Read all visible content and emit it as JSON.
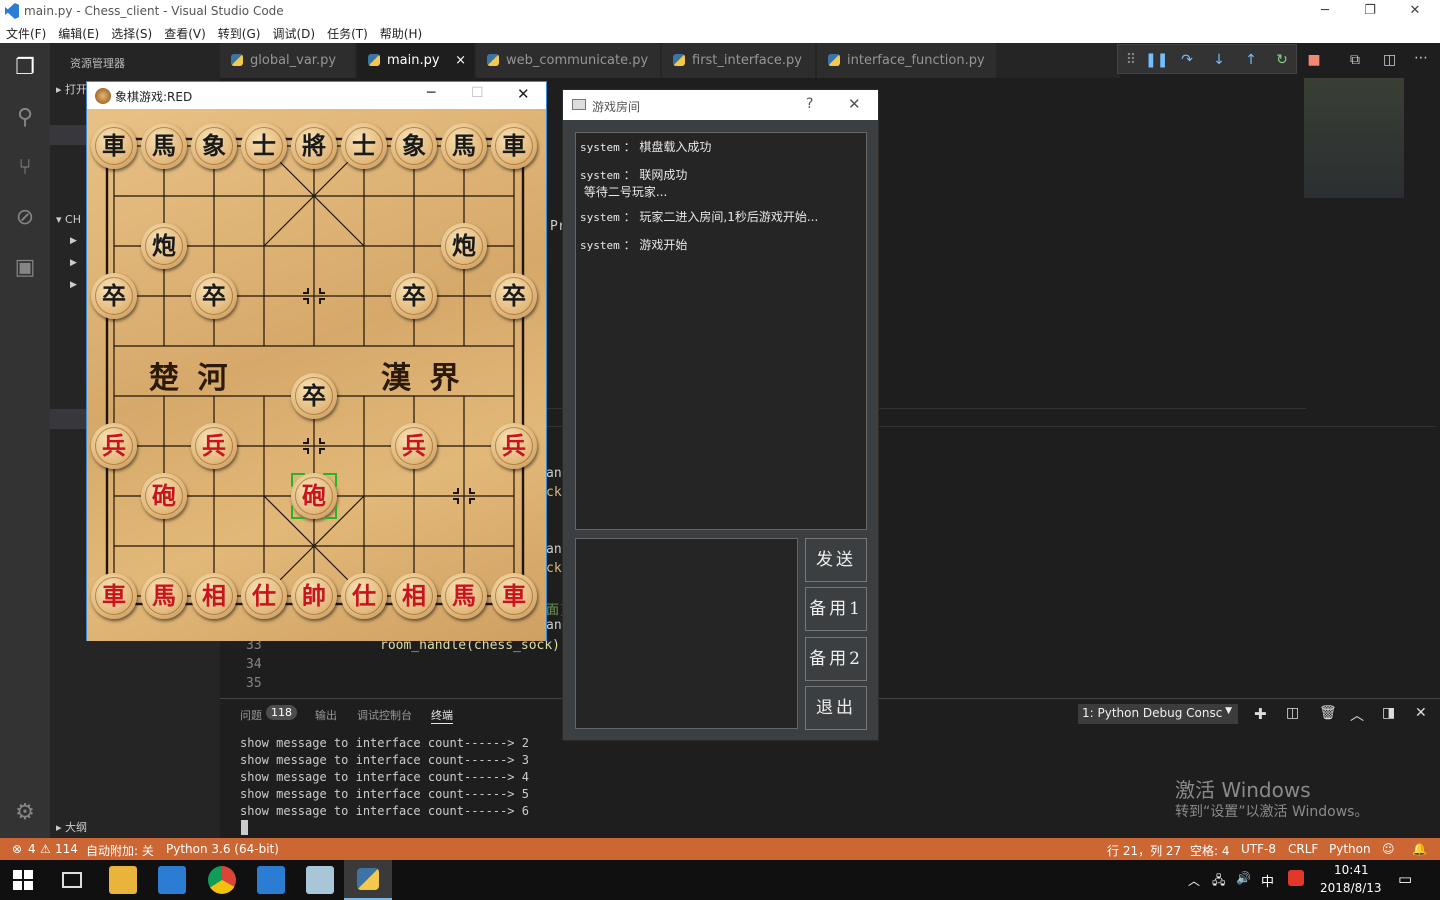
{
  "titlebar": {
    "title": "main.py - Chess_client - Visual Studio Code"
  },
  "menu": [
    "文件(F)",
    "编辑(E)",
    "选择(S)",
    "查看(V)",
    "转到(G)",
    "调试(D)",
    "任务(T)",
    "帮助(H)"
  ],
  "sidebar": {
    "header": "资源管理器",
    "open_label": "打开",
    "project_label": "CH",
    "outline_label": "大纲"
  },
  "tabs": [
    {
      "label": "global_var.py"
    },
    {
      "label": "main.py",
      "close": "×"
    },
    {
      "label": "web_communicate.py"
    },
    {
      "label": "first_interface.py"
    },
    {
      "label": "interface_function.py"
    }
  ],
  "editor": {
    "lines": [
      {
        "n": "33",
        "text": "room_handle(chess_sock)"
      },
      {
        "n": "34",
        "text": ""
      },
      {
        "n": "35",
        "text": ""
      }
    ],
    "fragments": [
      "Pr",
      "ank",
      "ck)",
      "ank",
      "ck)",
      "面)",
      "ank"
    ]
  },
  "panel": {
    "tabs": [
      "问题",
      "输出",
      "调试控制台",
      "终端"
    ],
    "problem_count": "118",
    "terminal_select": "1: Python Debug Consc",
    "terminal_lines": [
      "show message to interface count------> 2",
      "show message to interface count------> 3",
      "show message to interface count------> 4",
      "show message to interface count------> 5",
      "show message to interface count------> 6"
    ]
  },
  "status": {
    "errors": "4",
    "warnings": "114",
    "auto_attach": "自动附加: 关",
    "python": "Python 3.6 (64-bit)",
    "position": "行 21，列 27",
    "spaces": "空格: 4",
    "encoding": "UTF-8",
    "eol": "CRLF",
    "language": "Python"
  },
  "chess_window": {
    "title": "象棋游戏:RED",
    "river_left": "楚 河",
    "river_right": "漢 界"
  },
  "room_window": {
    "title": "游戏房间",
    "help": "?",
    "messages": [
      {
        "sender": "system",
        "text": "棋盘载入成功"
      },
      {
        "sender": "system",
        "text": "联网成功\n 等待二号玩家..."
      },
      {
        "sender": "system",
        "text": "玩家二进入房间,1秒后游戏开始..."
      },
      {
        "sender": "system",
        "text": "游戏开始"
      }
    ],
    "buttons": {
      "send": "发送",
      "spare1": "备用1",
      "spare2": "备用2",
      "quit": "退出"
    }
  },
  "watermark": {
    "line1": "激活 Windows",
    "line2": "转到“设置”以激活 Windows。"
  },
  "taskbar": {
    "time": "10:41",
    "date": "2018/8/13",
    "ime": "中"
  }
}
